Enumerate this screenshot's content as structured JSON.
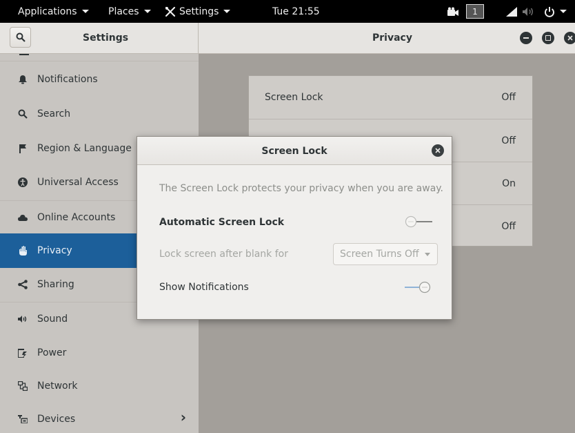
{
  "topbar": {
    "applications": "Applications",
    "places": "Places",
    "settings": "Settings",
    "clock": "Tue 21:55",
    "workspace": "1",
    "icons": [
      "settings-tools-icon",
      "video-camera-icon",
      "signal-icon",
      "volume-icon",
      "power-icon"
    ]
  },
  "header": {
    "sidebar_title": "Settings",
    "main_title": "Privacy"
  },
  "sidebar": {
    "items": [
      {
        "label": "Notifications",
        "icon": "bell-icon"
      },
      {
        "label": "Search",
        "icon": "search-icon"
      },
      {
        "label": "Region & Language",
        "icon": "flag-icon"
      },
      {
        "label": "Universal Access",
        "icon": "accessibility-icon"
      },
      {
        "label": "Online Accounts",
        "icon": "cloud-icon"
      },
      {
        "label": "Privacy",
        "icon": "hand-icon",
        "selected": true
      },
      {
        "label": "Sharing",
        "icon": "share-icon"
      },
      {
        "label": "Sound",
        "icon": "speaker-icon"
      },
      {
        "label": "Power",
        "icon": "battery-icon"
      },
      {
        "label": "Network",
        "icon": "network-icon"
      },
      {
        "label": "Devices",
        "icon": "devices-icon",
        "chevron": "›"
      }
    ]
  },
  "privacy_list": {
    "rows": [
      {
        "label": "Screen Lock",
        "value": "Off"
      },
      {
        "label": "",
        "value": "Off"
      },
      {
        "label": "",
        "value": "On"
      },
      {
        "label": "",
        "value": "Off"
      }
    ]
  },
  "dialog": {
    "title": "Screen Lock",
    "description": "The Screen Lock protects your privacy when you are away.",
    "auto_lock_label": "Automatic Screen Lock",
    "auto_lock_state": "off",
    "lock_after_label": "Lock screen after blank for",
    "lock_after_value": "Screen Turns Off",
    "show_notifications_label": "Show Notifications",
    "show_notifications_state": "on"
  },
  "colors": {
    "selected": "#1c5f9a",
    "sidebar_bg": "#c8c5c1",
    "main_bg": "#a39f9a",
    "dialog_bg": "#f0efed",
    "switch_accent": "#6f9fd0"
  }
}
